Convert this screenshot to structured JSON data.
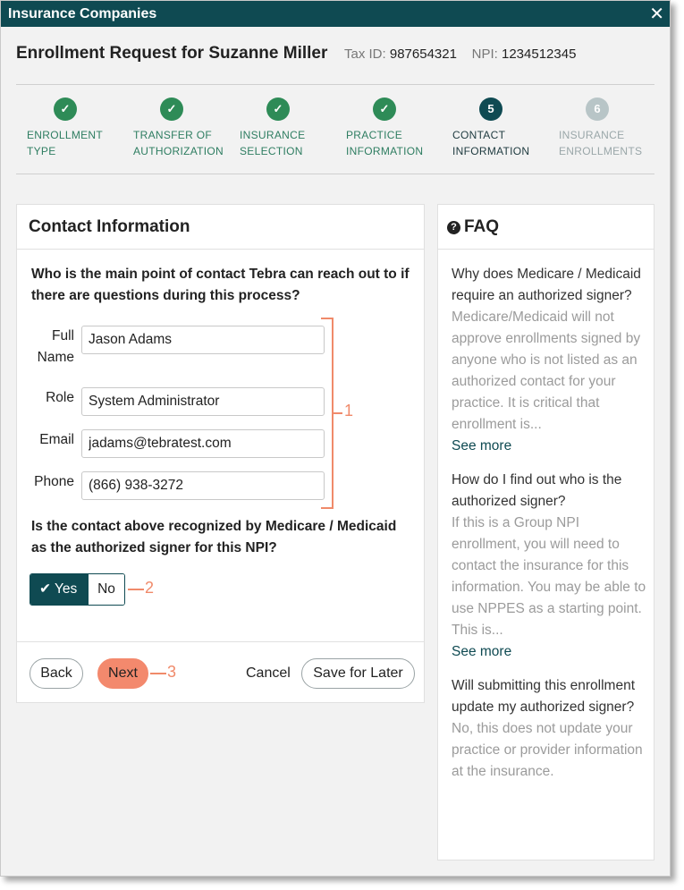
{
  "window": {
    "title": "Insurance Companies",
    "close_glyph": "✕"
  },
  "header": {
    "title": "Enrollment Request for Suzanne Miller",
    "tax_label": "Tax ID:",
    "tax_value": "987654321",
    "npi_label": "NPI:",
    "npi_value": "1234512345"
  },
  "steps": [
    {
      "number": "✓",
      "line1": "ENROLLMENT",
      "line2": "TYPE",
      "state": "done"
    },
    {
      "number": "✓",
      "line1": "TRANSFER OF",
      "line2": "AUTHORIZATION",
      "state": "done"
    },
    {
      "number": "✓",
      "line1": "INSURANCE",
      "line2": "SELECTION",
      "state": "done"
    },
    {
      "number": "✓",
      "line1": "PRACTICE",
      "line2": "INFORMATION",
      "state": "done"
    },
    {
      "number": "5",
      "line1": "CONTACT",
      "line2": "INFORMATION",
      "state": "current"
    },
    {
      "number": "6",
      "line1": "INSURANCE",
      "line2": "ENROLLMENTS",
      "state": "future"
    }
  ],
  "contact": {
    "title": "Contact Information",
    "question1_line1": "Who is the main point of contact Tebra can reach out to if",
    "question1_line2": "there are questions during this process?",
    "fields": {
      "full_name_label_1": "Full",
      "full_name_label_2": "Name",
      "full_name_value": "Jason Adams",
      "role_label": "Role",
      "role_value": "System Administrator",
      "email_label": "Email",
      "email_value": "jadams@tebratest.com",
      "phone_label": "Phone",
      "phone_value": "(866) 938-3272"
    },
    "question2_line1": "Is the contact above recognized by Medicare / Medicaid",
    "question2_line2": "as the authorized signer for this NPI?",
    "toggle": {
      "yes_label": "✔ Yes",
      "no_label": "No",
      "selected": "Yes"
    },
    "buttons": {
      "back": "Back",
      "next": "Next",
      "cancel": "Cancel",
      "save_later": "Save for Later"
    }
  },
  "annotations": {
    "a1": "1",
    "a2": "2",
    "a3": "3"
  },
  "faq": {
    "title": "FAQ",
    "icon": "question-circle-icon",
    "items": [
      {
        "question": "Why does Medicare / Medicaid require an authorized signer?",
        "answer": "Medicare/Medicaid will not approve enrollments signed by anyone who is not listed as an authorized contact for your practice. It is critical that enrollment is...",
        "more": "See more"
      },
      {
        "question": "How do I find out who is the authorized signer?",
        "answer": "If this is a Group NPI enrollment, you will need to contact the insurance for this information. You may be able to use NPPES as a starting point. This is...",
        "more": "See more"
      },
      {
        "question": "Will submitting this enrollment update my authorized signer?",
        "answer": "No, this does not update your practice or provider information at the insurance."
      }
    ]
  },
  "colors": {
    "brand": "#0f4a52",
    "done": "#2e8b57",
    "accent": "#f3896d",
    "annotation": "#f08a6a"
  }
}
